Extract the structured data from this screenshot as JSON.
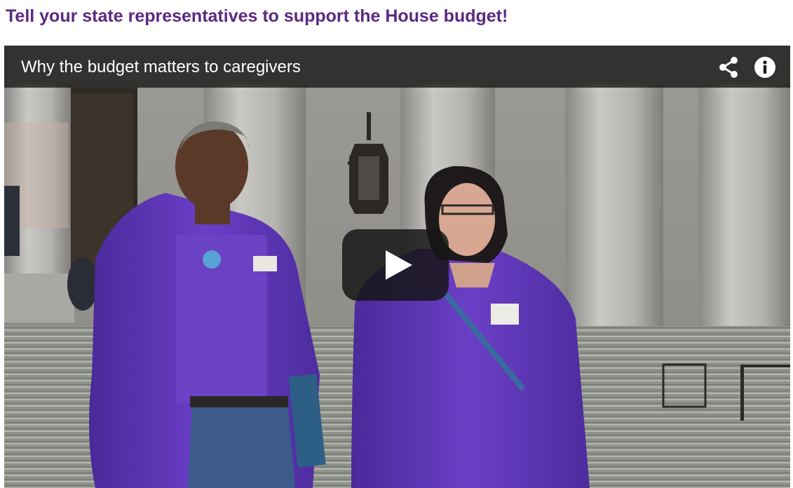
{
  "page": {
    "heading": "Tell your state representatives to support the House budget!",
    "heading_color": "#5a2a82"
  },
  "video": {
    "title": "Why the budget matters to caregivers",
    "controls": {
      "share_icon": "share-icon",
      "info_icon": "info-icon",
      "play_icon": "play-icon"
    }
  }
}
